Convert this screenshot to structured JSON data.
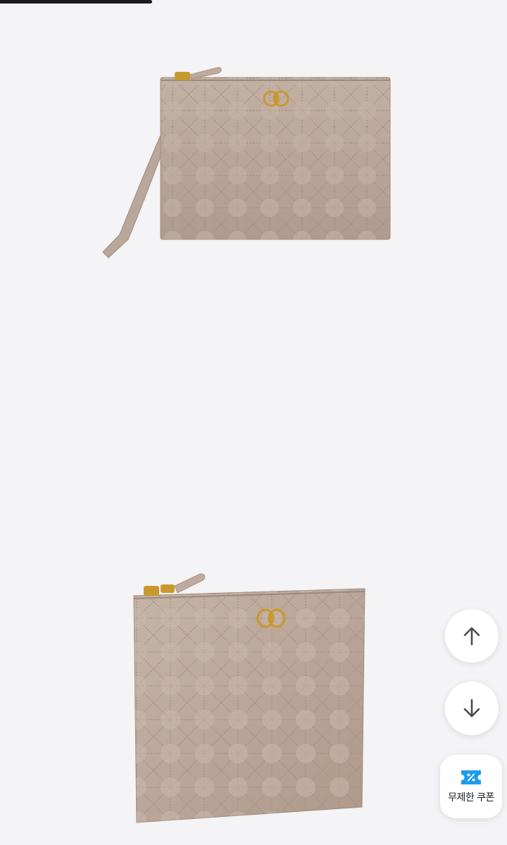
{
  "scroll": {
    "progress": 0.3
  },
  "gallery": {
    "images": [
      {
        "name": "quilted-pouch-front",
        "alt": ""
      },
      {
        "name": "quilted-pouch-angled",
        "alt": ""
      }
    ]
  },
  "floating_buttons": {
    "scroll_up_icon": "arrow-up-icon",
    "scroll_down_icon": "arrow-down-icon",
    "coupon_icon": "coupon-icon",
    "coupon_label": "무제한 쿠폰"
  },
  "colors": {
    "background": "#f4f3f6",
    "coupon_accent": "#1e9bf0",
    "leather": "#bca99b",
    "gold": "#c79a2a"
  }
}
